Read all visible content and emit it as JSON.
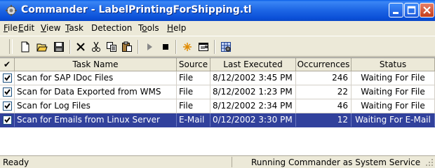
{
  "window": {
    "title": "Commander - LabelPrintingForShipping.tl"
  },
  "menu": [
    {
      "pre": "",
      "key": "F",
      "post": "ile"
    },
    {
      "pre": "",
      "key": "E",
      "post": "dit"
    },
    {
      "pre": "",
      "key": "V",
      "post": "iew"
    },
    {
      "pre": "",
      "key": "T",
      "post": "ask"
    },
    {
      "pre": "Detection",
      "key": "",
      "post": ""
    },
    {
      "pre": "T",
      "key": "o",
      "post": "ols"
    },
    {
      "pre": "",
      "key": "H",
      "post": "elp"
    }
  ],
  "toolbar": [
    "new-icon",
    "open-icon",
    "save-icon",
    "delete-icon",
    "cut-icon",
    "copy-icon",
    "paste-icon",
    "run-icon",
    "stop-icon",
    "spark-icon",
    "properties-icon",
    "grid-settings-icon"
  ],
  "table": {
    "columns": [
      "✔",
      "Task Name",
      "Source",
      "Last Executed",
      "Occurrences",
      "Status"
    ],
    "rows": [
      {
        "checked": true,
        "name": "Scan for SAP IDoc Files",
        "source": "File",
        "last": "8/12/2002 3:45 PM",
        "occ": "246",
        "status": "Waiting For File",
        "selected": false
      },
      {
        "checked": true,
        "name": "Scan for Data Exported from WMS",
        "source": "File",
        "last": "8/12/2002 1:23 PM",
        "occ": "22",
        "status": "Waiting For File",
        "selected": false
      },
      {
        "checked": true,
        "name": "Scan for Log Files",
        "source": "File",
        "last": "8/12/2002 2:34 PM",
        "occ": "46",
        "status": "Waiting For File",
        "selected": false
      },
      {
        "checked": true,
        "name": "Scan for Emails from Linux Server",
        "source": "E-Mail",
        "last": "0/12/2002 3:30 PM",
        "occ": "12",
        "status": "Waiting For E-Mail",
        "selected": true
      }
    ]
  },
  "status": {
    "left": "Ready",
    "right": "Running Commander as System Service"
  },
  "colors": {
    "title_bar": "#0a5ee8",
    "selection": "#31419c",
    "face": "#ece9d8"
  }
}
